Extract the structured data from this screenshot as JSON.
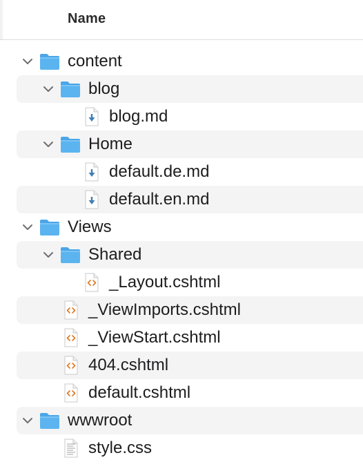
{
  "header": {
    "name_column": "Name"
  },
  "rows": [
    {
      "label": "content",
      "type": "folder",
      "depth": 0,
      "expanded": true
    },
    {
      "label": "blog",
      "type": "folder",
      "depth": 1,
      "expanded": true
    },
    {
      "label": "blog.md",
      "type": "markdown",
      "depth": 2
    },
    {
      "label": "Home",
      "type": "folder",
      "depth": 1,
      "expanded": true
    },
    {
      "label": "default.de.md",
      "type": "markdown",
      "depth": 2
    },
    {
      "label": "default.en.md",
      "type": "markdown",
      "depth": 2
    },
    {
      "label": "Views",
      "type": "folder",
      "depth": 0,
      "expanded": true
    },
    {
      "label": "Shared",
      "type": "folder",
      "depth": 1,
      "expanded": true
    },
    {
      "label": "_Layout.cshtml",
      "type": "code",
      "depth": 2
    },
    {
      "label": "_ViewImports.cshtml",
      "type": "code",
      "depth": 1
    },
    {
      "label": "_ViewStart.cshtml",
      "type": "code",
      "depth": 1
    },
    {
      "label": "404.cshtml",
      "type": "code",
      "depth": 1
    },
    {
      "label": "default.cshtml",
      "type": "code",
      "depth": 1
    },
    {
      "label": "wwwroot",
      "type": "folder",
      "depth": 0,
      "expanded": true
    },
    {
      "label": "style.css",
      "type": "css",
      "depth": 1
    }
  ],
  "colors": {
    "folder": "#5bb4f0",
    "folder_tab": "#4aa6e8",
    "markdown_arrow": "#3f7fb3",
    "code_brackets": "#e0771e",
    "stripe": "#f4f4f4",
    "text": "#1d1d1f"
  }
}
